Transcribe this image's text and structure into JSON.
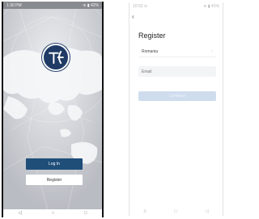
{
  "login_screen": {
    "status_bar": {
      "time": "1:30 PM",
      "right": "≋ ▮ 42%"
    },
    "logo_icon": "brand-logo-icon",
    "login_button": "Log In",
    "register_button": "Register",
    "nav": {
      "back": "◁",
      "home": "○",
      "recents": "□"
    },
    "colors": {
      "primary": "#1f4e79",
      "logo": "#1f3b66"
    }
  },
  "register_screen": {
    "status_bar": {
      "time": "10:52 ⊙",
      "right": "≋ ▮ 41%"
    },
    "back_icon": "‹",
    "title": "Register",
    "country_value": "Romania",
    "country_chevron": "›",
    "email_placeholder": "Email",
    "continue_button": "Continue",
    "nav": {
      "menu": "≡",
      "home": "□",
      "back": "◁"
    },
    "colors": {
      "button_disabled": "#cfdcee"
    }
  }
}
